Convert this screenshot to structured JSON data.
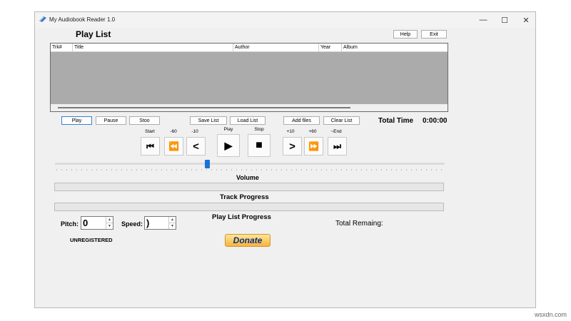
{
  "window": {
    "title": "My Audiobook Reader 1.0",
    "controls": {
      "minimize": "—",
      "maximize": "☐",
      "close": "✕"
    }
  },
  "header": {
    "playlist_title": "Play List",
    "help_label": "Help",
    "exit_label": "Exit"
  },
  "grid": {
    "columns": [
      "Trk#",
      "Title",
      "Author",
      "Year",
      "Album"
    ]
  },
  "controls": {
    "play_label": "Play",
    "pause_label": "Pause",
    "stop_label": "Stoo",
    "save_list_label": "Save List",
    "load_list_label": "Load List",
    "add_files_label": "Add files",
    "clear_list_label": "Clear List",
    "total_time_label": "Total Time",
    "total_time_value": "0:00:00"
  },
  "transport": {
    "labels": [
      "Start",
      "-60",
      "-10",
      "Play",
      "Stop",
      "+10",
      "+60",
      "~End"
    ],
    "glyphs": [
      "⏮",
      "⏪",
      "<",
      "▶",
      "■",
      ">",
      "⏩",
      "⏭"
    ]
  },
  "volume": {
    "label": "Volume",
    "level": 0.39
  },
  "track_progress": {
    "label": "Track Progress",
    "value": 0
  },
  "playlist_progress": {
    "label": "Play List Progress",
    "value": 0
  },
  "pitch": {
    "label": "Pitch:",
    "value": "0"
  },
  "speed": {
    "label": "Speed:",
    "value": ")"
  },
  "total_remaining_label": "Total Remaing:",
  "registration_status": "UNREGISTERED",
  "donate_label": "Donate",
  "watermark": "wsxdn.com",
  "colors": {
    "volume_thumb": "#1a73d9",
    "donate_bg": "#f6b43a",
    "donate_text": "#0b2f80"
  }
}
